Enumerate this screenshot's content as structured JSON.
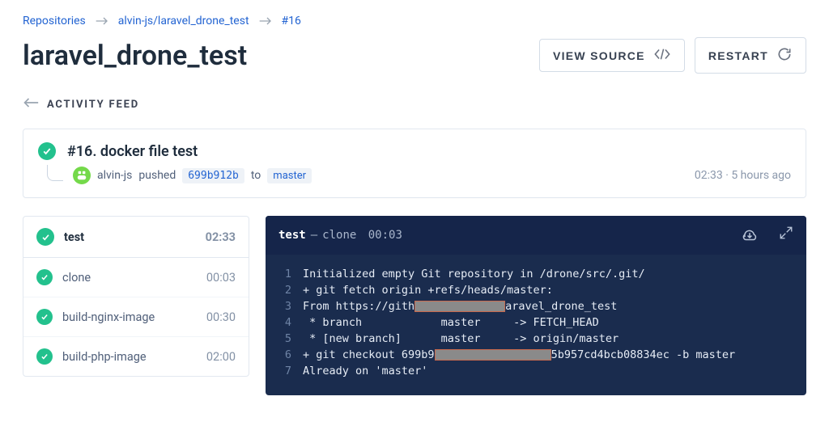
{
  "breadcrumbs": {
    "root": "Repositories",
    "repo": "alvin-js/laravel_drone_test",
    "build": "#16"
  },
  "page_title": "laravel_drone_test",
  "buttons": {
    "view_source": "VIEW SOURCE",
    "restart": "RESTART"
  },
  "activity_feed_label": "ACTIVITY FEED",
  "build": {
    "title": "#16. docker file test",
    "author": "alvin-js",
    "action_text": "pushed",
    "commit_sha_short": "699b912b",
    "to_word": "to",
    "ref": "master",
    "duration": "02:33",
    "age_sep": " · ",
    "age": "5 hours ago"
  },
  "stages": [
    {
      "name": "test",
      "time": "02:33"
    }
  ],
  "steps": [
    {
      "name": "clone",
      "time": "00:03"
    },
    {
      "name": "build-nginx-image",
      "time": "00:30"
    },
    {
      "name": "build-php-image",
      "time": "02:00"
    }
  ],
  "console": {
    "title": "test",
    "separator": " — ",
    "step": "clone",
    "step_time": "00:03",
    "lines": [
      "Initialized empty Git repository in /drone/src/.git/",
      "+ git fetch origin +refs/heads/master:",
      "From https://gith██████████████aravel_drone_test",
      " * branch            master     -> FETCH_HEAD",
      " * [new branch]      master     -> origin/master",
      "+ git checkout 699b9██████████████████5b957cd4bcb08834ec -b master",
      "Already on 'master'"
    ]
  }
}
